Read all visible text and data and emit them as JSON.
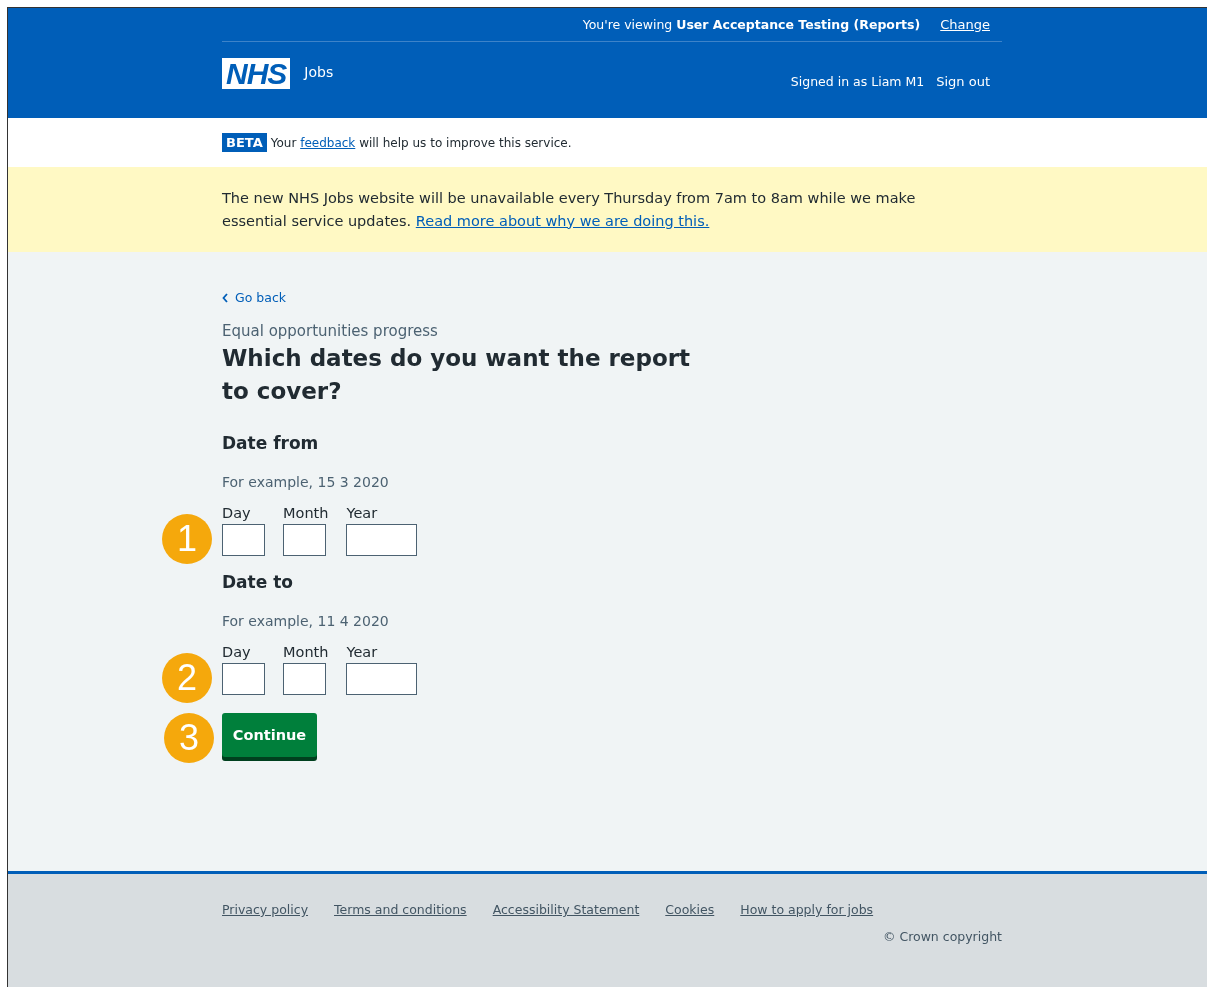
{
  "header": {
    "viewing_prefix": "You're viewing",
    "viewing_environment": "User Acceptance Testing (Reports)",
    "change_link": "Change",
    "logo": "NHS",
    "service_name": "Jobs",
    "signed_in": "Signed in as Liam M1",
    "sign_out": "Sign out"
  },
  "phase_banner": {
    "tag": "BETA",
    "text_before": "Your",
    "link": "feedback",
    "text_after": "will help us to improve this service."
  },
  "notice": {
    "text": "The new NHS Jobs website will be unavailable every Thursday from 7am to 8am while we make essential service updates.",
    "link": "Read more about why we are doing this."
  },
  "back_link": "Go back",
  "caption": "Equal opportunities progress",
  "heading": "Which dates do you want the report to cover?",
  "date_groups": [
    {
      "legend": "Date from",
      "hint": "For example, 15 3 2020",
      "callout": "1",
      "fields": [
        {
          "label": "Day",
          "kind": "short"
        },
        {
          "label": "Month",
          "kind": "short"
        },
        {
          "label": "Year",
          "kind": "long"
        }
      ]
    },
    {
      "legend": "Date to",
      "hint": "For example, 11 4 2020",
      "callout": "2",
      "fields": [
        {
          "label": "Day",
          "kind": "short"
        },
        {
          "label": "Month",
          "kind": "short"
        },
        {
          "label": "Year",
          "kind": "long"
        }
      ]
    }
  ],
  "continue_button": {
    "label": "Continue",
    "callout": "3"
  },
  "footer": {
    "links": [
      "Privacy policy",
      "Terms and conditions",
      "Accessibility Statement",
      "Cookies",
      "How to apply for jobs"
    ],
    "copyright": "© Crown copyright"
  }
}
